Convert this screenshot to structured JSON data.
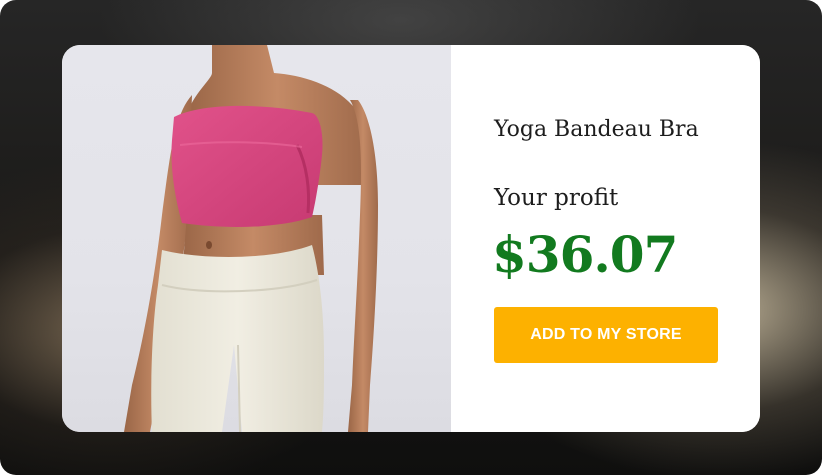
{
  "product": {
    "name": "Yoga Bandeau Bra",
    "profit_label": "Your profit",
    "profit_value": "$36.07",
    "add_button_label": "ADD TO MY STORE",
    "image_alt": "Model wearing pink bandeau top and cream ribbed leggings"
  },
  "colors": {
    "profit_green": "#127a1f",
    "button_yellow": "#fdb100",
    "top_pink": "#d6457e",
    "leggings_cream": "#ece9dc"
  }
}
